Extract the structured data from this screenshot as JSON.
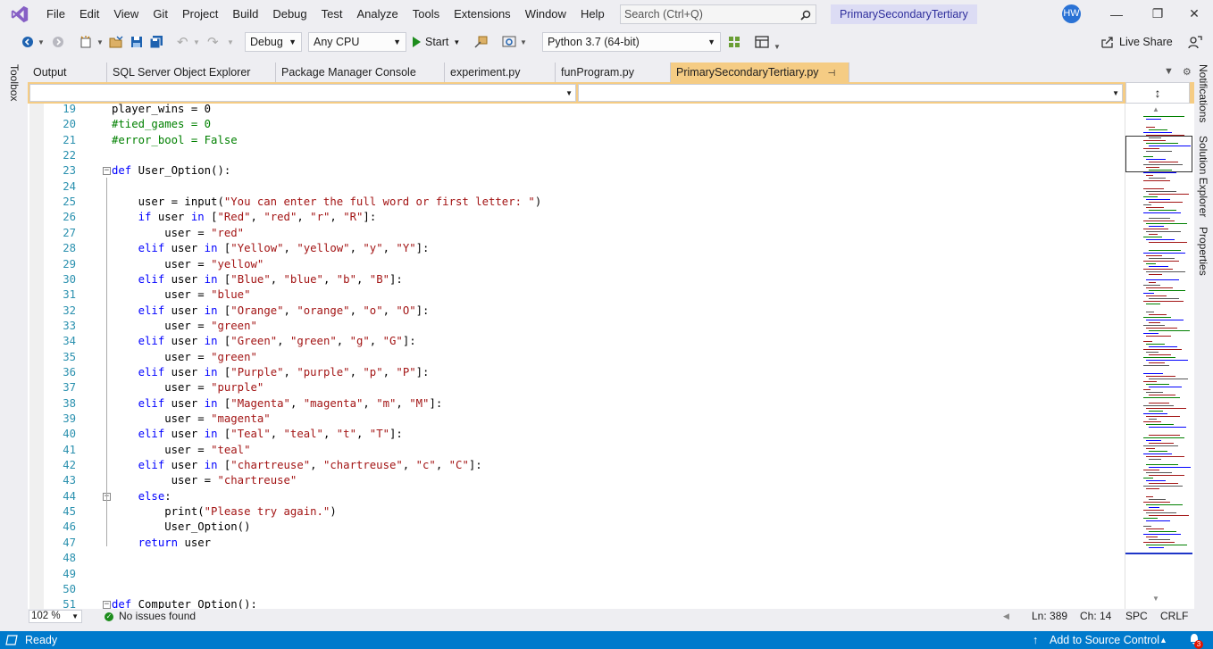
{
  "menu": [
    "File",
    "Edit",
    "View",
    "Git",
    "Project",
    "Build",
    "Debug",
    "Test",
    "Analyze",
    "Tools",
    "Extensions",
    "Window",
    "Help"
  ],
  "search": {
    "placeholder": "Search (Ctrl+Q)"
  },
  "solution_name": "PrimarySecondaryTertiary",
  "user_initials": "HW",
  "toolbar": {
    "config": "Debug",
    "platform": "Any CPU",
    "start_label": "Start",
    "interpreter": "Python 3.7 (64-bit)",
    "live_share": "Live Share"
  },
  "side_left": {
    "toolbox": "Toolbox"
  },
  "side_right": {
    "notifications": "Notifications",
    "solution_explorer": "Solution Explorer",
    "properties": "Properties"
  },
  "tabs": [
    {
      "label": "Output",
      "active": false
    },
    {
      "label": "SQL Server Object Explorer",
      "active": false
    },
    {
      "label": "Package Manager Console",
      "active": false
    },
    {
      "label": "experiment.py",
      "active": false
    },
    {
      "label": "funProgram.py",
      "active": false
    },
    {
      "label": "PrimarySecondaryTertiary.py",
      "active": true
    }
  ],
  "code_lines": [
    {
      "n": "19",
      "t": "player_wins = 0"
    },
    {
      "n": "20",
      "t": "#tied_games = 0"
    },
    {
      "n": "21",
      "t": "#error_bool = False"
    },
    {
      "n": "22",
      "t": ""
    },
    {
      "n": "23",
      "t": "def User_Option():"
    },
    {
      "n": "24",
      "t": ""
    },
    {
      "n": "25",
      "t": "    user = input(\"You can enter the full word or first letter: \")"
    },
    {
      "n": "26",
      "t": "    if user in [\"Red\", \"red\", \"r\", \"R\"]:"
    },
    {
      "n": "27",
      "t": "        user = \"red\""
    },
    {
      "n": "28",
      "t": "    elif user in [\"Yellow\", \"yellow\", \"y\", \"Y\"]:"
    },
    {
      "n": "29",
      "t": "        user = \"yellow\""
    },
    {
      "n": "30",
      "t": "    elif user in [\"Blue\", \"blue\", \"b\", \"B\"]:"
    },
    {
      "n": "31",
      "t": "        user = \"blue\""
    },
    {
      "n": "32",
      "t": "    elif user in [\"Orange\", \"orange\", \"o\", \"O\"]:"
    },
    {
      "n": "33",
      "t": "        user = \"green\""
    },
    {
      "n": "34",
      "t": "    elif user in [\"Green\", \"green\", \"g\", \"G\"]:"
    },
    {
      "n": "35",
      "t": "        user = \"green\""
    },
    {
      "n": "36",
      "t": "    elif user in [\"Purple\", \"purple\", \"p\", \"P\"]:"
    },
    {
      "n": "37",
      "t": "        user = \"purple\""
    },
    {
      "n": "38",
      "t": "    elif user in [\"Magenta\", \"magenta\", \"m\", \"M\"]:"
    },
    {
      "n": "39",
      "t": "        user = \"magenta\""
    },
    {
      "n": "40",
      "t": "    elif user in [\"Teal\", \"teal\", \"t\", \"T\"]:"
    },
    {
      "n": "41",
      "t": "        user = \"teal\""
    },
    {
      "n": "42",
      "t": "    elif user in [\"chartreuse\", \"chartreuse\", \"c\", \"C\"]:"
    },
    {
      "n": "43",
      "t": "         user = \"chartreuse\""
    },
    {
      "n": "44",
      "t": "    else:"
    },
    {
      "n": "45",
      "t": "        print(\"Please try again.\")"
    },
    {
      "n": "46",
      "t": "        User_Option()"
    },
    {
      "n": "47",
      "t": "    return user"
    },
    {
      "n": "48",
      "t": ""
    },
    {
      "n": "49",
      "t": ""
    },
    {
      "n": "50",
      "t": ""
    },
    {
      "n": "51",
      "t": "def Computer_Option():"
    }
  ],
  "editor_status": {
    "zoom": "102 %",
    "issues": "No issues found",
    "line": "Ln: 389",
    "col": "Ch: 14",
    "spc": "SPC",
    "eol": "CRLF"
  },
  "statusbar": {
    "ready": "Ready",
    "source_control": "Add to Source Control",
    "notif_count": "3"
  },
  "colors": {
    "accent": "#007acc",
    "tab_active": "#f5cc84",
    "keyword": "#0000ff",
    "string": "#a31515",
    "comment": "#008000",
    "line_number": "#2b91af"
  }
}
